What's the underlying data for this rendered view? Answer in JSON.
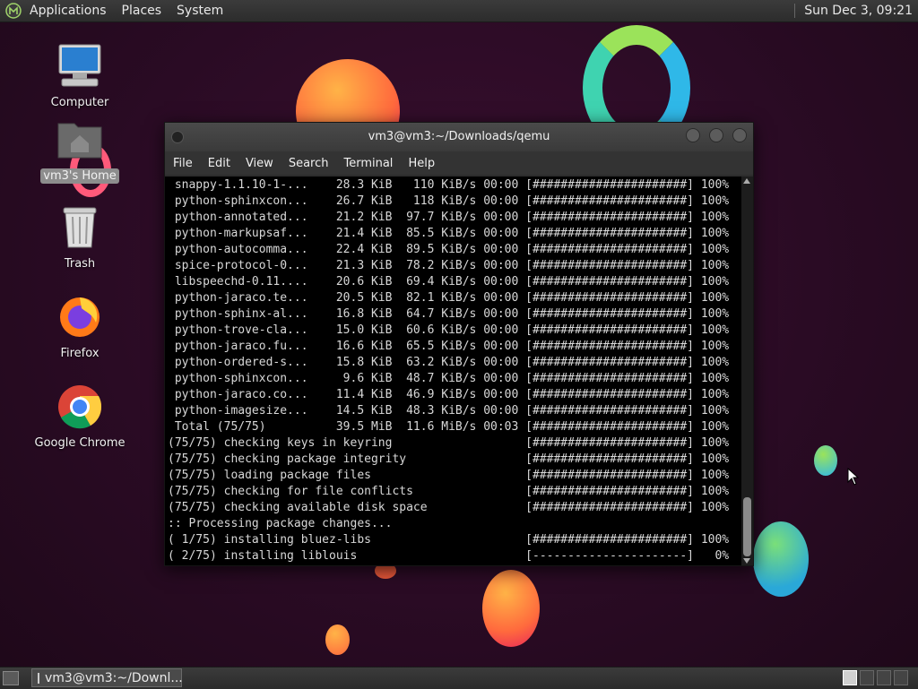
{
  "top_panel": {
    "menus": [
      "Applications",
      "Places",
      "System"
    ],
    "clock": "Sun Dec  3, 09:21"
  },
  "desktop_icons": [
    {
      "label": "Computer",
      "icon": "computer-icon"
    },
    {
      "label": "vm3's Home",
      "icon": "home-folder-icon"
    },
    {
      "label": "Trash",
      "icon": "trash-icon"
    },
    {
      "label": "Firefox",
      "icon": "firefox-icon"
    },
    {
      "label": "Google Chrome",
      "icon": "chrome-icon"
    }
  ],
  "terminal": {
    "title": "vm3@vm3:~/Downloads/qemu",
    "menu": [
      "File",
      "Edit",
      "View",
      "Search",
      "Terminal",
      "Help"
    ],
    "lines": [
      " snappy-1.1.10-1-...    28.3 KiB   110 KiB/s 00:00 [######################] 100%",
      " python-sphinxcon...    26.7 KiB   118 KiB/s 00:00 [######################] 100%",
      " python-annotated...    21.2 KiB  97.7 KiB/s 00:00 [######################] 100%",
      " python-markupsaf...    21.4 KiB  85.5 KiB/s 00:00 [######################] 100%",
      " python-autocomma...    22.4 KiB  89.5 KiB/s 00:00 [######################] 100%",
      " spice-protocol-0...    21.3 KiB  78.2 KiB/s 00:00 [######################] 100%",
      " libspeechd-0.11....    20.6 KiB  69.4 KiB/s 00:00 [######################] 100%",
      " python-jaraco.te...    20.5 KiB  82.1 KiB/s 00:00 [######################] 100%",
      " python-sphinx-al...    16.8 KiB  64.7 KiB/s 00:00 [######################] 100%",
      " python-trove-cla...    15.0 KiB  60.6 KiB/s 00:00 [######################] 100%",
      " python-jaraco.fu...    16.6 KiB  65.5 KiB/s 00:00 [######################] 100%",
      " python-ordered-s...    15.8 KiB  63.2 KiB/s 00:00 [######################] 100%",
      " python-sphinxcon...     9.6 KiB  48.7 KiB/s 00:00 [######################] 100%",
      " python-jaraco.co...    11.4 KiB  46.9 KiB/s 00:00 [######################] 100%",
      " python-imagesize...    14.5 KiB  48.3 KiB/s 00:00 [######################] 100%",
      " Total (75/75)          39.5 MiB  11.6 MiB/s 00:03 [######################] 100%",
      "(75/75) checking keys in keyring                   [######################] 100%",
      "(75/75) checking package integrity                 [######################] 100%",
      "(75/75) loading package files                      [######################] 100%",
      "(75/75) checking for file conflicts                [######################] 100%",
      "(75/75) checking available disk space              [######################] 100%",
      ":: Processing package changes...",
      "( 1/75) installing bluez-libs                      [######################] 100%",
      "( 2/75) installing liblouis                        [----------------------]   0%"
    ]
  },
  "taskbar": {
    "window_label": "vm3@vm3:~/Downl..."
  },
  "colors": {
    "wallpaper": "#2a0b24",
    "terminal_bg": "#000000",
    "terminal_fg": "#d8d8d8",
    "panel_bg": "#333333"
  }
}
